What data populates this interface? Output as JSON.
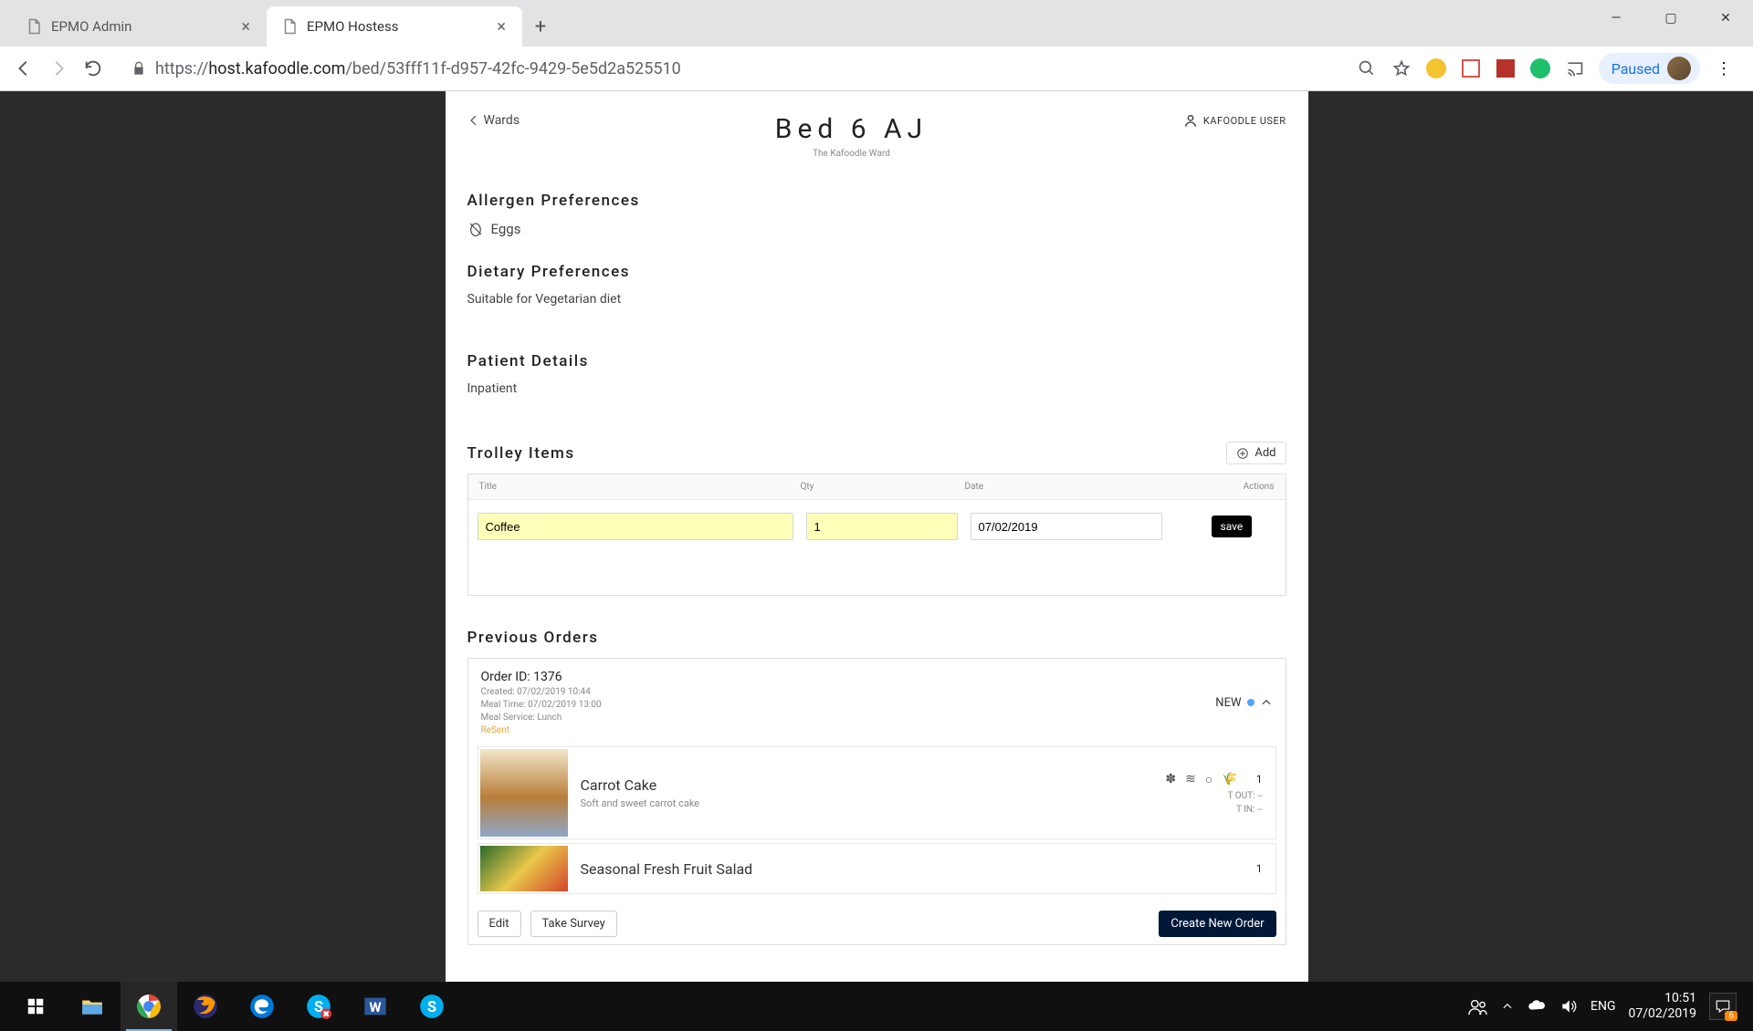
{
  "browser": {
    "tabs": [
      {
        "title": "EPMO Admin",
        "active": false
      },
      {
        "title": "EPMO Hostess",
        "active": true
      }
    ],
    "url_proto": "https://",
    "url_host": "host.kafoodle.com",
    "url_path": "/bed/53fff11f-d957-42fc-9429-5e5d2a525510",
    "paused_label": "Paused"
  },
  "header": {
    "back_label": "Wards",
    "title": "Bed 6 AJ",
    "subtitle": "The Kafoodle Ward",
    "user": "KAFOODLE USER"
  },
  "allergens": {
    "heading": "Allergen Preferences",
    "items": [
      "Eggs"
    ]
  },
  "dietary": {
    "heading": "Dietary Preferences",
    "text": "Suitable for Vegetarian diet"
  },
  "patient": {
    "heading": "Patient Details",
    "text": "Inpatient"
  },
  "trolley": {
    "heading": "Trolley Items",
    "add_label": "Add",
    "cols": {
      "title": "Title",
      "qty": "Qty",
      "date": "Date",
      "actions": "Actions"
    },
    "row": {
      "title": "Coffee",
      "qty": "1",
      "date": "07/02/2019"
    },
    "save_label": "save"
  },
  "prev": {
    "heading": "Previous Orders",
    "order_id": "Order ID: 1376",
    "created": "Created: 07/02/2019 10:44",
    "meal_time": "Meal Time: 07/02/2019 13:00",
    "meal_service": "Meal Service: Lunch",
    "resent": "ReSent",
    "status": "NEW",
    "items": [
      {
        "name": "Carrot Cake",
        "desc": "Soft and sweet carrot cake",
        "qty": "1",
        "t_out": "T  OUT:        --",
        "t_in": "T  IN:        --"
      },
      {
        "name": "Seasonal Fresh Fruit Salad",
        "desc": "",
        "qty": "1",
        "t_out": "",
        "t_in": ""
      }
    ],
    "edit_label": "Edit",
    "survey_label": "Take Survey",
    "create_label": "Create New Order"
  },
  "taskbar": {
    "lang": "ENG",
    "time": "10:51",
    "date": "07/02/2019",
    "notif": "6"
  }
}
